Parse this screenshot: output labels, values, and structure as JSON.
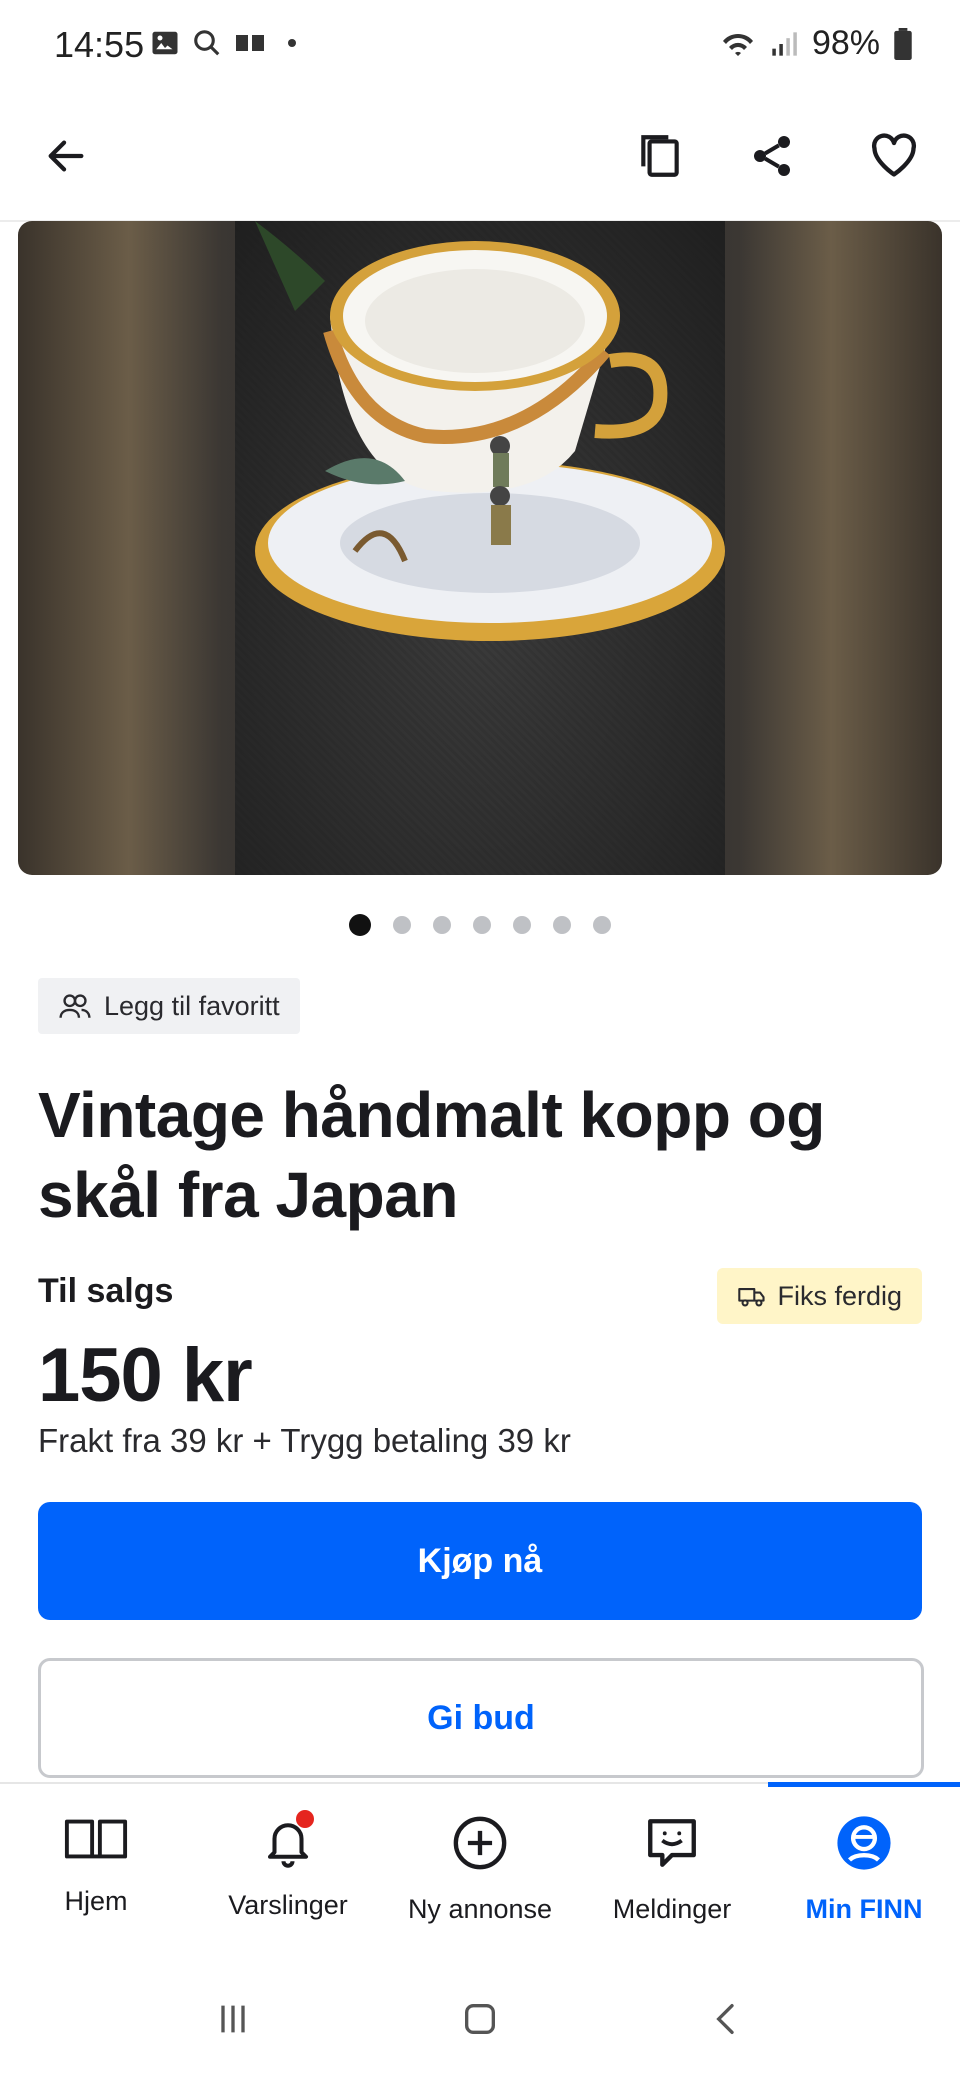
{
  "status_bar": {
    "time": "14:55",
    "battery": "98%"
  },
  "toolbar": {
    "back_icon": "arrow-left-icon",
    "copy_icon": "copy-icon",
    "share_icon": "share-icon",
    "favorite_icon": "heart-icon"
  },
  "gallery": {
    "image_count": 7,
    "active_index": 0
  },
  "favorite_chip": {
    "label": "Legg til favoritt"
  },
  "listing": {
    "title": "Vintage håndmalt kopp og skål fra Japan",
    "sale_label": "Til salgs",
    "badge": "Fiks ferdig",
    "price": "150 kr",
    "shipping": "Frakt fra 39 kr + Trygg betaling 39 kr"
  },
  "actions": {
    "buy": "Kjøp nå",
    "bid": "Gi bud"
  },
  "bottom_nav": [
    {
      "label": "Hjem",
      "icon": "book-icon"
    },
    {
      "label": "Varslinger",
      "icon": "bell-icon"
    },
    {
      "label": "Ny annonse",
      "icon": "plus-circle-icon"
    },
    {
      "label": "Meldinger",
      "icon": "chat-icon"
    },
    {
      "label": "Min FINN",
      "icon": "profile-icon"
    }
  ],
  "colors": {
    "primary": "#0063fb",
    "badge_bg": "#fff5c8",
    "notification": "#e5251e"
  }
}
